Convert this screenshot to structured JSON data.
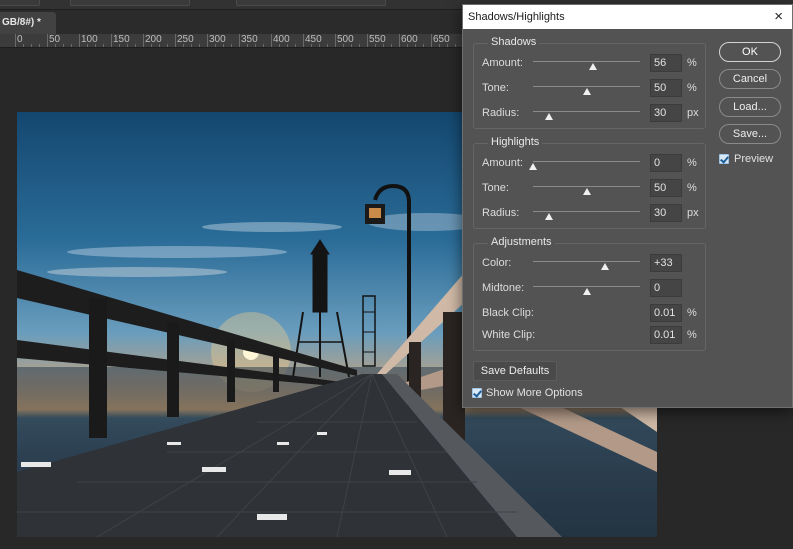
{
  "document": {
    "tab_title": "GB/8#) *",
    "tab_close": "×"
  },
  "ruler": {
    "ticks": [
      "0",
      "50",
      "100",
      "150",
      "200",
      "250",
      "300",
      "350",
      "400",
      "450",
      "500",
      "550",
      "600",
      "650"
    ]
  },
  "dialog": {
    "title": "Shadows/Highlights",
    "close_glyph": "×",
    "shadows": {
      "title": "Shadows",
      "amount": {
        "label": "Amount:",
        "value": "56",
        "unit": "%",
        "level": 0.56
      },
      "tone": {
        "label": "Tone:",
        "value": "50",
        "unit": "%",
        "level": 0.5
      },
      "radius": {
        "label": "Radius:",
        "value": "30",
        "unit": "px",
        "level": 0.15
      }
    },
    "highlights": {
      "title": "Highlights",
      "amount": {
        "label": "Amount:",
        "value": "0",
        "unit": "%",
        "level": 0.0
      },
      "tone": {
        "label": "Tone:",
        "value": "50",
        "unit": "%",
        "level": 0.5
      },
      "radius": {
        "label": "Radius:",
        "value": "30",
        "unit": "px",
        "level": 0.15
      }
    },
    "adjustments": {
      "title": "Adjustments",
      "color": {
        "label": "Color:",
        "value": "+33",
        "level": 0.67
      },
      "midtone": {
        "label": "Midtone:",
        "value": "0",
        "level": 0.5
      },
      "black_clip": {
        "label": "Black Clip:",
        "value": "0.01",
        "unit": "%"
      },
      "white_clip": {
        "label": "White Clip:",
        "value": "0.01",
        "unit": "%"
      }
    },
    "buttons": {
      "ok": "OK",
      "cancel": "Cancel",
      "load": "Load...",
      "save": "Save..."
    },
    "preview": {
      "label": "Preview",
      "checked": true
    },
    "save_defaults": "Save Defaults",
    "show_more": {
      "label": "Show More Options",
      "checked": true
    }
  },
  "colors": {
    "dialog_bg": "#535353",
    "canvas_bg": "#282828",
    "title_bg": "#ffffff",
    "check_accent": "#1d5e99"
  }
}
